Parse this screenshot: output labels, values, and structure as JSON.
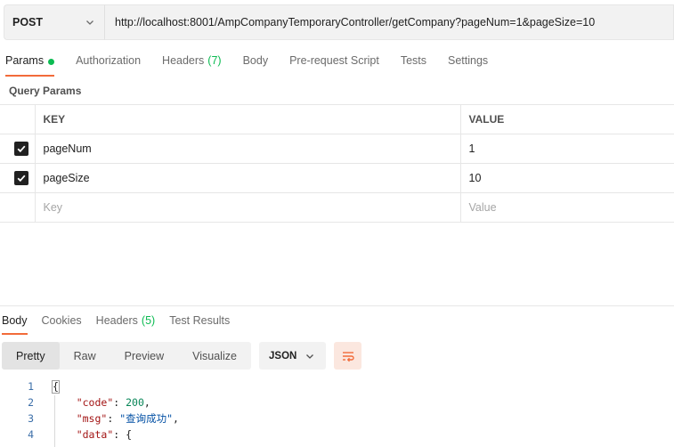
{
  "request": {
    "method": "POST",
    "url": "http://localhost:8001/AmpCompanyTemporaryController/getCompany?pageNum=1&pageSize=10"
  },
  "request_tabs": [
    {
      "label": "Params",
      "active": true,
      "dot": true
    },
    {
      "label": "Authorization"
    },
    {
      "label": "Headers",
      "count": "(7)"
    },
    {
      "label": "Body"
    },
    {
      "label": "Pre-request Script"
    },
    {
      "label": "Tests"
    },
    {
      "label": "Settings"
    }
  ],
  "query_params": {
    "title": "Query Params",
    "headers": {
      "key": "KEY",
      "value": "VALUE"
    },
    "rows": [
      {
        "checked": true,
        "key": "pageNum",
        "value": "1"
      },
      {
        "checked": true,
        "key": "pageSize",
        "value": "10"
      }
    ],
    "placeholder": {
      "key": "Key",
      "value": "Value"
    }
  },
  "response_tabs": [
    {
      "label": "Body",
      "active": true
    },
    {
      "label": "Cookies"
    },
    {
      "label": "Headers",
      "count": "(5)"
    },
    {
      "label": "Test Results"
    }
  ],
  "view_modes": [
    {
      "label": "Pretty",
      "active": true
    },
    {
      "label": "Raw"
    },
    {
      "label": "Preview"
    },
    {
      "label": "Visualize"
    }
  ],
  "format": "JSON",
  "code_lines": [
    {
      "n": "1",
      "text": "{"
    },
    {
      "n": "2",
      "key": "\"code\"",
      "sep": ": ",
      "num": "200",
      "end": ","
    },
    {
      "n": "3",
      "key": "\"msg\"",
      "sep": ": ",
      "str": "\"查询成功\"",
      "end": ","
    },
    {
      "n": "4",
      "key": "\"data\"",
      "sep": ": ",
      "end": "{"
    }
  ],
  "colors": {
    "accent": "#f26b3a",
    "success": "#0cbb52"
  },
  "icons": {
    "method_dropdown": "chevron-down-icon",
    "format_dropdown": "chevron-down-icon",
    "wrap": "wrap-lines-icon",
    "checkbox": "checkmark-icon"
  }
}
